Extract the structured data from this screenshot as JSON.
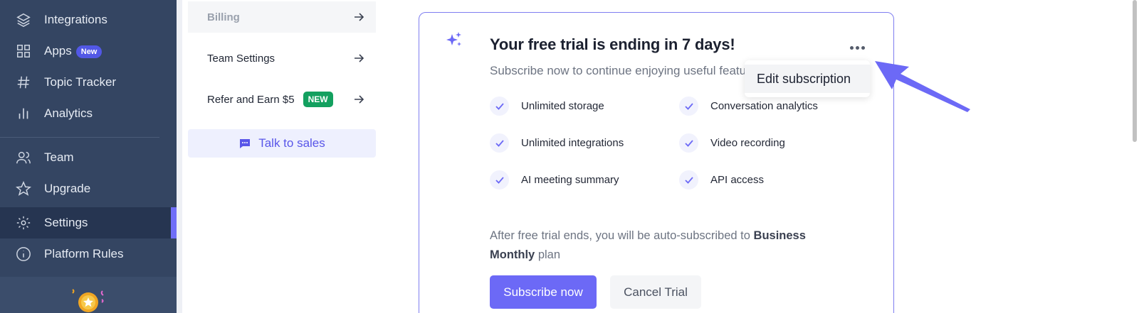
{
  "sidebar": {
    "items": [
      {
        "label": "Integrations",
        "icon": "layers-icon"
      },
      {
        "label": "Apps",
        "icon": "grid-icon",
        "badge": "New"
      },
      {
        "label": "Topic Tracker",
        "icon": "hash-icon"
      },
      {
        "label": "Analytics",
        "icon": "bar-chart-icon"
      },
      {
        "label": "Team",
        "icon": "users-icon"
      },
      {
        "label": "Upgrade",
        "icon": "star-icon"
      },
      {
        "label": "Settings",
        "icon": "gear-icon",
        "active": true
      },
      {
        "label": "Platform Rules",
        "icon": "info-icon"
      }
    ]
  },
  "submenu": {
    "billing": "Billing",
    "team_settings": "Team Settings",
    "refer": "Refer and Earn $5",
    "refer_badge": "NEW",
    "talk_to_sales": "Talk to sales"
  },
  "card": {
    "title": "Your free trial is ending in 7 days!",
    "subtitle": "Subscribe now to continue enjoying useful featu",
    "features_left": [
      "Unlimited storage",
      "Unlimited integrations",
      "AI meeting summary"
    ],
    "features_right": [
      "Conversation analytics",
      "Video recording",
      "API access"
    ],
    "after_prefix": "After free trial ends, you will be auto-subscribed to ",
    "after_plan": "Business Monthly",
    "after_suffix": " plan",
    "subscribe_label": "Subscribe now",
    "cancel_label": "Cancel Trial"
  },
  "dropdown": {
    "edit_subscription": "Edit subscription"
  },
  "colors": {
    "sidebar_bg": "#344562",
    "accent": "#6c69f6",
    "new_badge": "#13a05f"
  }
}
